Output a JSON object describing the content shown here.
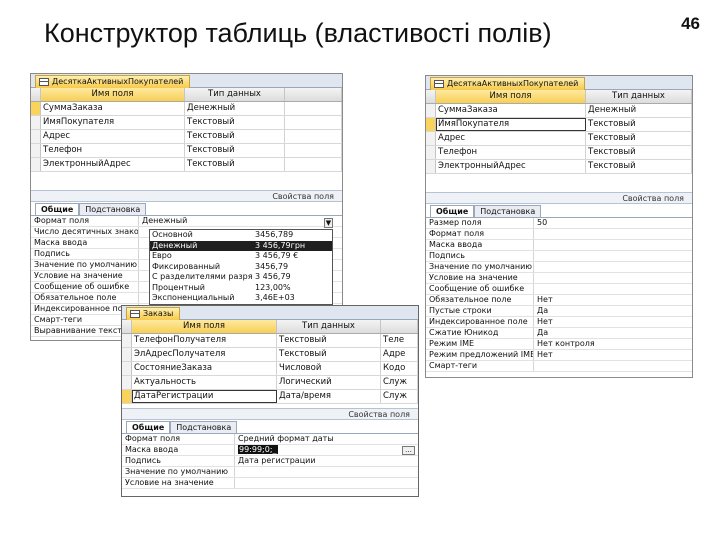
{
  "slide": {
    "title": "Конструктор таблиць (властивості полів)",
    "page_number": "46"
  },
  "grid_headers": {
    "field_name": "Имя поля",
    "data_type": "Тип данных"
  },
  "win1": {
    "tab": "ДесяткаАктивныхПокупателей",
    "rows": [
      {
        "name": "СуммаЗаказа",
        "type": "Денежный"
      },
      {
        "name": "ИмяПокупателя",
        "type": "Текстовый"
      },
      {
        "name": "Адрес",
        "type": "Текстовый"
      },
      {
        "name": "Телефон",
        "type": "Текстовый"
      },
      {
        "name": "ЭлектронныйАдрес",
        "type": "Текстовый"
      }
    ],
    "props_caption": "Свойства поля",
    "tabs": [
      "Общие",
      "Подстановка"
    ],
    "props": [
      {
        "name": "Формат поля",
        "value": "Денежный"
      },
      {
        "name": "Число десятичных знаков",
        "value": ""
      },
      {
        "name": "Маска ввода",
        "value": ""
      },
      {
        "name": "Подпись",
        "value": ""
      },
      {
        "name": "Значение по умолчанию",
        "value": ""
      },
      {
        "name": "Условие на значение",
        "value": ""
      },
      {
        "name": "Сообщение об ошибке",
        "value": ""
      },
      {
        "name": "Обязательное поле",
        "value": ""
      },
      {
        "name": "Индексированное поле",
        "value": ""
      },
      {
        "name": "Смарт-теги",
        "value": ""
      },
      {
        "name": "Выравнивание текста",
        "value": ""
      }
    ],
    "format_options": [
      {
        "name": "Основной",
        "sample": "3456,789"
      },
      {
        "name": "Денежный",
        "sample": "3 456,79грн"
      },
      {
        "name": "Евро",
        "sample": "3 456,79 €"
      },
      {
        "name": "Фиксированный",
        "sample": "3456,79"
      },
      {
        "name": "С разделителями разрядов",
        "sample": "3 456,79"
      },
      {
        "name": "Процентный",
        "sample": "123,00%"
      },
      {
        "name": "Экспоненциальный",
        "sample": "3,46Е+03"
      }
    ],
    "combo_arrow": "▼"
  },
  "win2": {
    "tab": "ДесяткаАктивныхПокупателей",
    "rows": [
      {
        "name": "СуммаЗаказа",
        "type": "Денежный"
      },
      {
        "name": "ИмяПокупателя",
        "type": "Текстовый"
      },
      {
        "name": "Адрес",
        "type": "Текстовый"
      },
      {
        "name": "Телефон",
        "type": "Текстовый"
      },
      {
        "name": "ЭлектронныйАдрес",
        "type": "Текстовый"
      }
    ],
    "props_caption": "Свойства поля",
    "tabs": [
      "Общие",
      "Подстановка"
    ],
    "props": [
      {
        "name": "Размер поля",
        "value": "50"
      },
      {
        "name": "Формат поля",
        "value": ""
      },
      {
        "name": "Маска ввода",
        "value": ""
      },
      {
        "name": "Подпись",
        "value": ""
      },
      {
        "name": "Значение по умолчанию",
        "value": ""
      },
      {
        "name": "Условие на значение",
        "value": ""
      },
      {
        "name": "Сообщение об ошибке",
        "value": ""
      },
      {
        "name": "Обязательное поле",
        "value": "Нет"
      },
      {
        "name": "Пустые строки",
        "value": "Да"
      },
      {
        "name": "Индексированное поле",
        "value": "Нет"
      },
      {
        "name": "Сжатие Юникод",
        "value": "Да"
      },
      {
        "name": "Режим IME",
        "value": "Нет контроля"
      },
      {
        "name": "Режим предложений IME",
        "value": "Нет"
      },
      {
        "name": "Смарт-теги",
        "value": ""
      }
    ]
  },
  "win3": {
    "tab": "Заказы",
    "rows": [
      {
        "name": "ТелефонПолучателя",
        "type": "Текстовый",
        "extra": "Теле"
      },
      {
        "name": "ЭлАдресПолучателя",
        "type": "Текстовый",
        "extra": "Адре"
      },
      {
        "name": "СостояниеЗаказа",
        "type": "Числовой",
        "extra": "Кодо"
      },
      {
        "name": "Актуальность",
        "type": "Логический",
        "extra": "Служ"
      },
      {
        "name": "ДатаРегистрации",
        "type": "Дата/время",
        "extra": "Служ"
      }
    ],
    "props_caption": "Свойства поля",
    "tabs": [
      "Общие",
      "Подстановка"
    ],
    "props": [
      {
        "name": "Формат поля",
        "value": "Средний формат даты"
      },
      {
        "name": "Маска ввода",
        "value": "99:99;0;_"
      },
      {
        "name": "Подпись",
        "value": "Дата регистрации"
      },
      {
        "name": "Значение по умолчанию",
        "value": ""
      },
      {
        "name": "Условие на значение",
        "value": ""
      }
    ],
    "dots": "..."
  }
}
